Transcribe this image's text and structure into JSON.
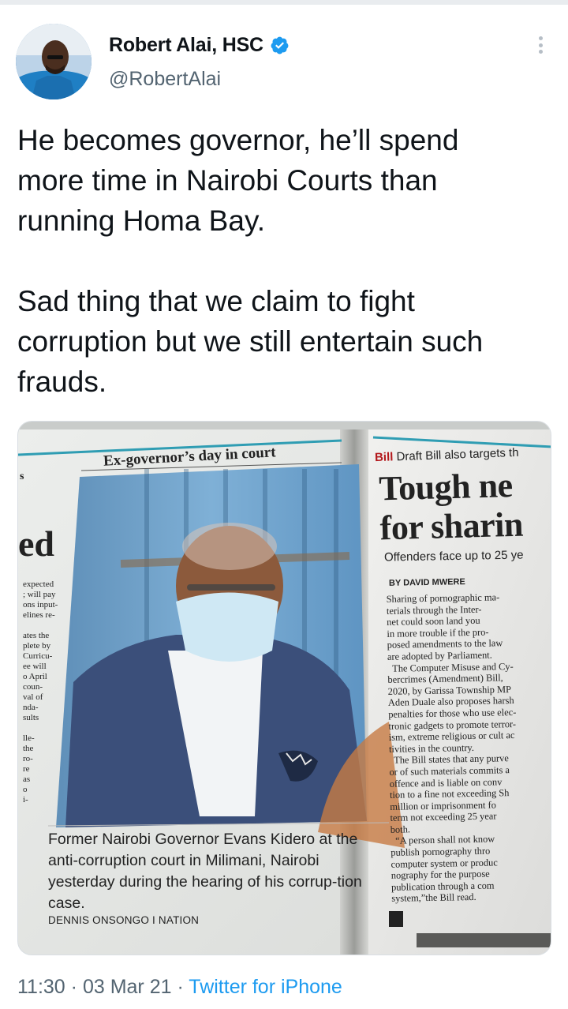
{
  "author": {
    "display_name": "Robert Alai, HSC",
    "handle": "@RobertAlai",
    "verified": true,
    "verified_color": "#1d9bf0"
  },
  "tweet": {
    "text": "He becomes governor, he’ll spend\nmore time in Nairobi Courts than\nrunning Homa Bay.\n\nSad thing that we claim to fight\ncorruption but we still entertain such\nfrauds."
  },
  "media": {
    "left_page": {
      "kicker": "Ex-governor’s day in court",
      "caption": "Former Nairobi Governor Evans Kidero at the anti-corruption court in Milimani, Nairobi yesterday during the hearing of his corrup-tion case.",
      "credit": "DENNIS ONSONGO I NATION",
      "fragment_big": "ed",
      "fragment_s": "s",
      "fragment_column": "expected\n; will pay\nons input-\nelines re-\n\nates the\nplete by\nCurricu-\nee will\no April\ncoun-\nval of\nnda-\nsults\n\nlle-\nthe\nro-\nre\nas\no\ni-"
    },
    "right_page": {
      "section_label": "Bill",
      "section_text": "Draft Bill also targets th",
      "headline": "Tough ne\nfor sharin",
      "standfirst": "Offenders face up to 25 ye",
      "byline": "BY DAVID MWERE",
      "body": "Sharing of pornographic ma-\nterials through the Inter-\nnet could soon land you\nin more trouble if the pro-\nposed amendments to the law\nare adopted by Parliament.\n  The Computer Misuse and Cy-\nbercrimes (Amendment) Bill,\n2020, by Garissa Township MP\nAden Duale also proposes harsh\npenalties for those who use elec-\ntronic gadgets to promote terror-\nism, extreme religious or cult ac\ntivities in the country.\n  The Bill states that any purve\nor of such materials commits a\noffence and is liable on conv\ntion to a fine not exceeding Sh\nmillion or imprisonment fo\nterm not exceeding 25 year\nboth.\n  “A person shall not know\npublish pornography thro\ncomputer system or produc\nnography for the purpose\npublication through a com\nsystem,”the Bill read."
    }
  },
  "meta": {
    "time": "11:30",
    "separator": "·",
    "date": "03 Mar 21",
    "source": "Twitter for iPhone"
  }
}
